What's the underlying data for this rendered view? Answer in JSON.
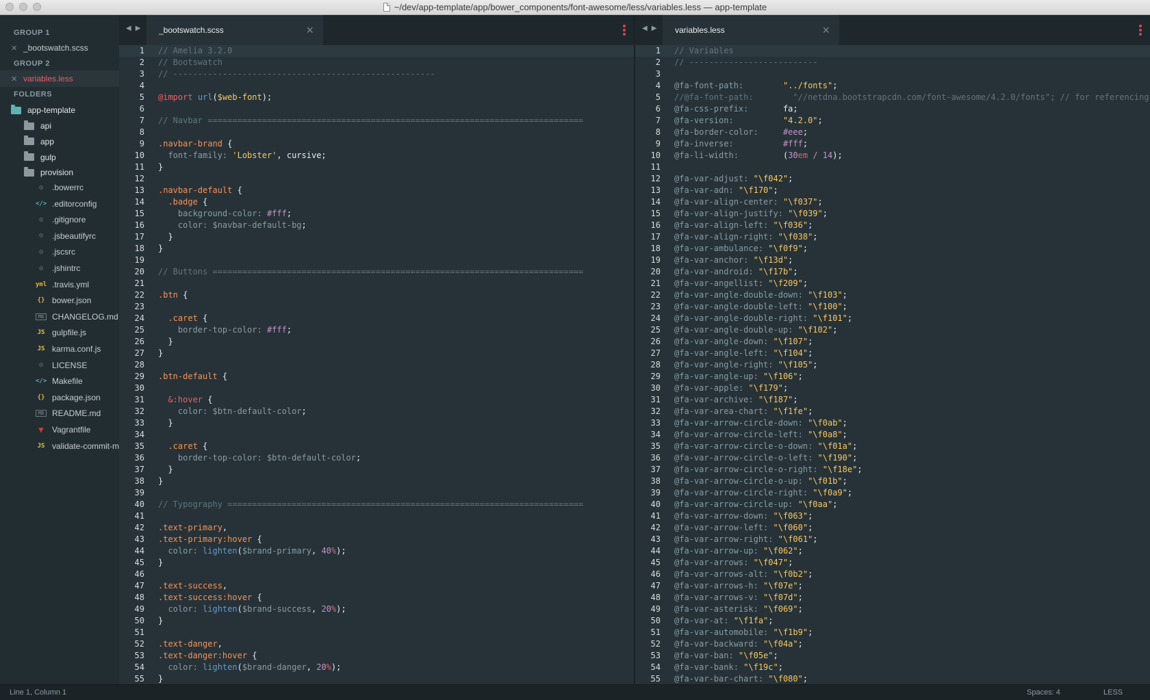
{
  "window": {
    "title": "~/dev/app-template/app/bower_components/font-awesome/less/variables.less — app-template"
  },
  "sidebar": {
    "group1": "GROUP 1",
    "group1_file": "_bootswatch.scss",
    "group2": "GROUP 2",
    "group2_file": "variables.less",
    "folders": "FOLDERS",
    "root": "app-template",
    "dirs": [
      "api",
      "app",
      "gulp",
      "provision"
    ],
    "files": [
      {
        "icon": "dot",
        "name": ".bowerrc"
      },
      {
        "icon": "code",
        "name": ".editorconfig"
      },
      {
        "icon": "dot",
        "name": ".gitignore"
      },
      {
        "icon": "dot",
        "name": ".jsbeautifyrc"
      },
      {
        "icon": "dot",
        "name": ".jscsrc"
      },
      {
        "icon": "dot",
        "name": ".jshintrc"
      },
      {
        "icon": "yml",
        "name": ".travis.yml"
      },
      {
        "icon": "json",
        "name": "bower.json"
      },
      {
        "icon": "md",
        "name": "CHANGELOG.md"
      },
      {
        "icon": "js",
        "name": "gulpfile.js"
      },
      {
        "icon": "js",
        "name": "karma.conf.js"
      },
      {
        "icon": "dot",
        "name": "LICENSE"
      },
      {
        "icon": "code",
        "name": "Makefile"
      },
      {
        "icon": "json",
        "name": "package.json"
      },
      {
        "icon": "md",
        "name": "README.md"
      },
      {
        "icon": "vag",
        "name": "Vagrantfile"
      },
      {
        "icon": "js",
        "name": "validate-commit-m"
      }
    ]
  },
  "left_pane": {
    "tab_label": "_bootswatch.scss",
    "lines": [
      [
        [
          "cm",
          "// Amelia 3.2.0"
        ]
      ],
      [
        [
          "cm",
          "// Bootswatch"
        ]
      ],
      [
        [
          "cm",
          "// -----------------------------------------------------"
        ]
      ],
      [],
      [
        [
          "kw",
          "@import"
        ],
        [
          "wh",
          " "
        ],
        [
          "fn",
          "url"
        ],
        [
          "wh",
          "("
        ],
        [
          "str",
          "$web-font"
        ],
        [
          "wh",
          ");"
        ]
      ],
      [],
      [
        [
          "cm",
          "// Navbar ============================================================================"
        ]
      ],
      [],
      [
        [
          "sel",
          ".navbar-brand"
        ],
        [
          "wh",
          " {"
        ]
      ],
      [
        [
          "prop",
          "  font-family: "
        ],
        [
          "str",
          "'Lobster'"
        ],
        [
          "wh",
          ", cursive;"
        ]
      ],
      [
        [
          "wh",
          "}"
        ]
      ],
      [],
      [
        [
          "sel",
          ".navbar-default"
        ],
        [
          "wh",
          " {"
        ]
      ],
      [
        [
          "sel",
          "  .badge"
        ],
        [
          "wh",
          " {"
        ]
      ],
      [
        [
          "prop",
          "    background-color: "
        ],
        [
          "num-c",
          "#fff"
        ],
        [
          "wh",
          ";"
        ]
      ],
      [
        [
          "prop",
          "    color: $navbar-default-bg"
        ],
        [
          "wh",
          ";"
        ]
      ],
      [
        [
          "wh",
          "  }"
        ]
      ],
      [
        [
          "wh",
          "}"
        ]
      ],
      [],
      [
        [
          "cm",
          "// Buttons ==========================================================================="
        ]
      ],
      [],
      [
        [
          "sel",
          ".btn"
        ],
        [
          "wh",
          " {"
        ]
      ],
      [],
      [
        [
          "sel",
          "  .caret"
        ],
        [
          "wh",
          " {"
        ]
      ],
      [
        [
          "prop",
          "    border-top-color: "
        ],
        [
          "num-c",
          "#fff"
        ],
        [
          "wh",
          ";"
        ]
      ],
      [
        [
          "wh",
          "  }"
        ]
      ],
      [
        [
          "wh",
          "}"
        ]
      ],
      [],
      [
        [
          "sel",
          ".btn-default"
        ],
        [
          "wh",
          " {"
        ]
      ],
      [],
      [
        [
          "kw",
          "  &:hover"
        ],
        [
          "wh",
          " {"
        ]
      ],
      [
        [
          "prop",
          "    color: $btn-default-color"
        ],
        [
          "wh",
          ";"
        ]
      ],
      [
        [
          "wh",
          "  }"
        ]
      ],
      [],
      [
        [
          "sel",
          "  .caret"
        ],
        [
          "wh",
          " {"
        ]
      ],
      [
        [
          "prop",
          "    border-top-color: $btn-default-color"
        ],
        [
          "wh",
          ";"
        ]
      ],
      [
        [
          "wh",
          "  }"
        ]
      ],
      [
        [
          "wh",
          "}"
        ]
      ],
      [],
      [
        [
          "cm",
          "// Typography ========================================================================"
        ]
      ],
      [],
      [
        [
          "sel",
          ".text-primary"
        ],
        [
          "wh",
          ","
        ]
      ],
      [
        [
          "sel",
          ".text-primary:hover"
        ],
        [
          "wh",
          " {"
        ]
      ],
      [
        [
          "prop",
          "  color: "
        ],
        [
          "fn",
          "lighten"
        ],
        [
          "wh",
          "("
        ],
        [
          "prop",
          "$brand-primary"
        ],
        [
          "wh",
          ", "
        ],
        [
          "num-c",
          "40"
        ],
        [
          "pct",
          "%"
        ],
        [
          "wh",
          ");"
        ]
      ],
      [
        [
          "wh",
          "}"
        ]
      ],
      [],
      [
        [
          "sel",
          ".text-success"
        ],
        [
          "wh",
          ","
        ]
      ],
      [
        [
          "sel",
          ".text-success:hover"
        ],
        [
          "wh",
          " {"
        ]
      ],
      [
        [
          "prop",
          "  color: "
        ],
        [
          "fn",
          "lighten"
        ],
        [
          "wh",
          "("
        ],
        [
          "prop",
          "$brand-success"
        ],
        [
          "wh",
          ", "
        ],
        [
          "num-c",
          "20"
        ],
        [
          "pct",
          "%"
        ],
        [
          "wh",
          ");"
        ]
      ],
      [
        [
          "wh",
          "}"
        ]
      ],
      [],
      [
        [
          "sel",
          ".text-danger"
        ],
        [
          "wh",
          ","
        ]
      ],
      [
        [
          "sel",
          ".text-danger:hover"
        ],
        [
          "wh",
          " {"
        ]
      ],
      [
        [
          "prop",
          "  color: "
        ],
        [
          "fn",
          "lighten"
        ],
        [
          "wh",
          "("
        ],
        [
          "prop",
          "$brand-danger"
        ],
        [
          "wh",
          ", "
        ],
        [
          "num-c",
          "20"
        ],
        [
          "pct",
          "%"
        ],
        [
          "wh",
          ");"
        ]
      ],
      [
        [
          "wh",
          "}"
        ]
      ]
    ]
  },
  "right_pane": {
    "tab_label": "variables.less",
    "lines": [
      [
        [
          "cm",
          "// Variables"
        ]
      ],
      [
        [
          "cm",
          "// --------------------------"
        ]
      ],
      [],
      [
        [
          "prop",
          "@fa-font-path:        "
        ],
        [
          "str",
          "\"../fonts\""
        ],
        [
          "wh",
          ";"
        ]
      ],
      [
        [
          "cm",
          "//@fa-font-path:        \"//netdna.bootstrapcdn.com/font-awesome/4.2.0/fonts\"; // for referencing Bootstrap CDN font files directly"
        ]
      ],
      [
        [
          "prop",
          "@fa-css-prefix:       "
        ],
        [
          "wh",
          "fa;"
        ]
      ],
      [
        [
          "prop",
          "@fa-version:          "
        ],
        [
          "str",
          "\"4.2.0\""
        ],
        [
          "wh",
          ";"
        ]
      ],
      [
        [
          "prop",
          "@fa-border-color:     "
        ],
        [
          "num-c",
          "#eee"
        ],
        [
          "wh",
          ";"
        ]
      ],
      [
        [
          "prop",
          "@fa-inverse:          "
        ],
        [
          "num-c",
          "#fff"
        ],
        [
          "wh",
          ";"
        ]
      ],
      [
        [
          "prop",
          "@fa-li-width:         "
        ],
        [
          "wh",
          "("
        ],
        [
          "num-c",
          "30"
        ],
        [
          "kw",
          "em"
        ],
        [
          "wh",
          " "
        ],
        [
          "num-c",
          "/ 14"
        ],
        [
          "wh",
          ");"
        ]
      ],
      [],
      [
        [
          "prop",
          "@fa-var-adjust: "
        ],
        [
          "str",
          "\"\\f042\""
        ],
        [
          "wh",
          ";"
        ]
      ],
      [
        [
          "prop",
          "@fa-var-adn: "
        ],
        [
          "str",
          "\"\\f170\""
        ],
        [
          "wh",
          ";"
        ]
      ],
      [
        [
          "prop",
          "@fa-var-align-center: "
        ],
        [
          "str",
          "\"\\f037\""
        ],
        [
          "wh",
          ";"
        ]
      ],
      [
        [
          "prop",
          "@fa-var-align-justify: "
        ],
        [
          "str",
          "\"\\f039\""
        ],
        [
          "wh",
          ";"
        ]
      ],
      [
        [
          "prop",
          "@fa-var-align-left: "
        ],
        [
          "str",
          "\"\\f036\""
        ],
        [
          "wh",
          ";"
        ]
      ],
      [
        [
          "prop",
          "@fa-var-align-right: "
        ],
        [
          "str",
          "\"\\f038\""
        ],
        [
          "wh",
          ";"
        ]
      ],
      [
        [
          "prop",
          "@fa-var-ambulance: "
        ],
        [
          "str",
          "\"\\f0f9\""
        ],
        [
          "wh",
          ";"
        ]
      ],
      [
        [
          "prop",
          "@fa-var-anchor: "
        ],
        [
          "str",
          "\"\\f13d\""
        ],
        [
          "wh",
          ";"
        ]
      ],
      [
        [
          "prop",
          "@fa-var-android: "
        ],
        [
          "str",
          "\"\\f17b\""
        ],
        [
          "wh",
          ";"
        ]
      ],
      [
        [
          "prop",
          "@fa-var-angellist: "
        ],
        [
          "str",
          "\"\\f209\""
        ],
        [
          "wh",
          ";"
        ]
      ],
      [
        [
          "prop",
          "@fa-var-angle-double-down: "
        ],
        [
          "str",
          "\"\\f103\""
        ],
        [
          "wh",
          ";"
        ]
      ],
      [
        [
          "prop",
          "@fa-var-angle-double-left: "
        ],
        [
          "str",
          "\"\\f100\""
        ],
        [
          "wh",
          ";"
        ]
      ],
      [
        [
          "prop",
          "@fa-var-angle-double-right: "
        ],
        [
          "str",
          "\"\\f101\""
        ],
        [
          "wh",
          ";"
        ]
      ],
      [
        [
          "prop",
          "@fa-var-angle-double-up: "
        ],
        [
          "str",
          "\"\\f102\""
        ],
        [
          "wh",
          ";"
        ]
      ],
      [
        [
          "prop",
          "@fa-var-angle-down: "
        ],
        [
          "str",
          "\"\\f107\""
        ],
        [
          "wh",
          ";"
        ]
      ],
      [
        [
          "prop",
          "@fa-var-angle-left: "
        ],
        [
          "str",
          "\"\\f104\""
        ],
        [
          "wh",
          ";"
        ]
      ],
      [
        [
          "prop",
          "@fa-var-angle-right: "
        ],
        [
          "str",
          "\"\\f105\""
        ],
        [
          "wh",
          ";"
        ]
      ],
      [
        [
          "prop",
          "@fa-var-angle-up: "
        ],
        [
          "str",
          "\"\\f106\""
        ],
        [
          "wh",
          ";"
        ]
      ],
      [
        [
          "prop",
          "@fa-var-apple: "
        ],
        [
          "str",
          "\"\\f179\""
        ],
        [
          "wh",
          ";"
        ]
      ],
      [
        [
          "prop",
          "@fa-var-archive: "
        ],
        [
          "str",
          "\"\\f187\""
        ],
        [
          "wh",
          ";"
        ]
      ],
      [
        [
          "prop",
          "@fa-var-area-chart: "
        ],
        [
          "str",
          "\"\\f1fe\""
        ],
        [
          "wh",
          ";"
        ]
      ],
      [
        [
          "prop",
          "@fa-var-arrow-circle-down: "
        ],
        [
          "str",
          "\"\\f0ab\""
        ],
        [
          "wh",
          ";"
        ]
      ],
      [
        [
          "prop",
          "@fa-var-arrow-circle-left: "
        ],
        [
          "str",
          "\"\\f0a8\""
        ],
        [
          "wh",
          ";"
        ]
      ],
      [
        [
          "prop",
          "@fa-var-arrow-circle-o-down: "
        ],
        [
          "str",
          "\"\\f01a\""
        ],
        [
          "wh",
          ";"
        ]
      ],
      [
        [
          "prop",
          "@fa-var-arrow-circle-o-left: "
        ],
        [
          "str",
          "\"\\f190\""
        ],
        [
          "wh",
          ";"
        ]
      ],
      [
        [
          "prop",
          "@fa-var-arrow-circle-o-right: "
        ],
        [
          "str",
          "\"\\f18e\""
        ],
        [
          "wh",
          ";"
        ]
      ],
      [
        [
          "prop",
          "@fa-var-arrow-circle-o-up: "
        ],
        [
          "str",
          "\"\\f01b\""
        ],
        [
          "wh",
          ";"
        ]
      ],
      [
        [
          "prop",
          "@fa-var-arrow-circle-right: "
        ],
        [
          "str",
          "\"\\f0a9\""
        ],
        [
          "wh",
          ";"
        ]
      ],
      [
        [
          "prop",
          "@fa-var-arrow-circle-up: "
        ],
        [
          "str",
          "\"\\f0aa\""
        ],
        [
          "wh",
          ";"
        ]
      ],
      [
        [
          "prop",
          "@fa-var-arrow-down: "
        ],
        [
          "str",
          "\"\\f063\""
        ],
        [
          "wh",
          ";"
        ]
      ],
      [
        [
          "prop",
          "@fa-var-arrow-left: "
        ],
        [
          "str",
          "\"\\f060\""
        ],
        [
          "wh",
          ";"
        ]
      ],
      [
        [
          "prop",
          "@fa-var-arrow-right: "
        ],
        [
          "str",
          "\"\\f061\""
        ],
        [
          "wh",
          ";"
        ]
      ],
      [
        [
          "prop",
          "@fa-var-arrow-up: "
        ],
        [
          "str",
          "\"\\f062\""
        ],
        [
          "wh",
          ";"
        ]
      ],
      [
        [
          "prop",
          "@fa-var-arrows: "
        ],
        [
          "str",
          "\"\\f047\""
        ],
        [
          "wh",
          ";"
        ]
      ],
      [
        [
          "prop",
          "@fa-var-arrows-alt: "
        ],
        [
          "str",
          "\"\\f0b2\""
        ],
        [
          "wh",
          ";"
        ]
      ],
      [
        [
          "prop",
          "@fa-var-arrows-h: "
        ],
        [
          "str",
          "\"\\f07e\""
        ],
        [
          "wh",
          ";"
        ]
      ],
      [
        [
          "prop",
          "@fa-var-arrows-v: "
        ],
        [
          "str",
          "\"\\f07d\""
        ],
        [
          "wh",
          ";"
        ]
      ],
      [
        [
          "prop",
          "@fa-var-asterisk: "
        ],
        [
          "str",
          "\"\\f069\""
        ],
        [
          "wh",
          ";"
        ]
      ],
      [
        [
          "prop",
          "@fa-var-at: "
        ],
        [
          "str",
          "\"\\f1fa\""
        ],
        [
          "wh",
          ";"
        ]
      ],
      [
        [
          "prop",
          "@fa-var-automobile: "
        ],
        [
          "str",
          "\"\\f1b9\""
        ],
        [
          "wh",
          ";"
        ]
      ],
      [
        [
          "prop",
          "@fa-var-backward: "
        ],
        [
          "str",
          "\"\\f04a\""
        ],
        [
          "wh",
          ";"
        ]
      ],
      [
        [
          "prop",
          "@fa-var-ban: "
        ],
        [
          "str",
          "\"\\f05e\""
        ],
        [
          "wh",
          ";"
        ]
      ],
      [
        [
          "prop",
          "@fa-var-bank: "
        ],
        [
          "str",
          "\"\\f19c\""
        ],
        [
          "wh",
          ";"
        ]
      ],
      [
        [
          "prop",
          "@fa-var-bar-chart: "
        ],
        [
          "str",
          "\"\\f080\""
        ],
        [
          "wh",
          ";"
        ]
      ]
    ]
  },
  "status": {
    "position": "Line 1, Column 1",
    "spaces": "Spaces: 4",
    "syntax": "LESS"
  }
}
